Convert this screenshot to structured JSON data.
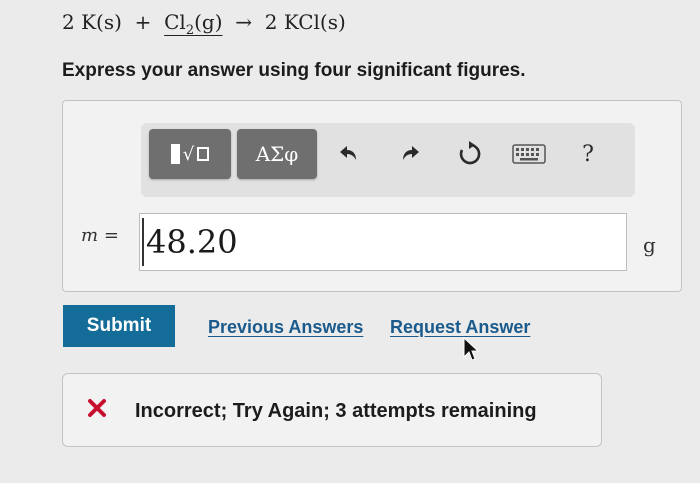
{
  "equation": {
    "coef1": "2",
    "reactant1": "K(s)",
    "plus": "+",
    "reactant2_main": "Cl",
    "reactant2_sub": "2",
    "reactant2_state": "(g)",
    "arrow": "→",
    "coef2": "2",
    "product": "KCl(s)"
  },
  "instruction": "Express your answer using four significant figures.",
  "toolbar": {
    "greek_label": "ΑΣφ",
    "help_label": "?",
    "icons": [
      "templates-icon",
      "undo-icon",
      "redo-icon",
      "reset-icon",
      "keyboard-icon",
      "help-icon"
    ]
  },
  "answer": {
    "variable": "m",
    "equals": "=",
    "value": "48.20",
    "unit": "g"
  },
  "actions": {
    "submit_label": "Submit",
    "previous_answers_label": "Previous Answers",
    "request_answer_label": "Request Answer"
  },
  "feedback": {
    "text": "Incorrect; Try Again; 3 attempts remaining",
    "status_color": "#c8102e"
  },
  "colors": {
    "submit": "#136d98",
    "link": "#1a5a8c",
    "tool_button": "#6f6f6f"
  }
}
